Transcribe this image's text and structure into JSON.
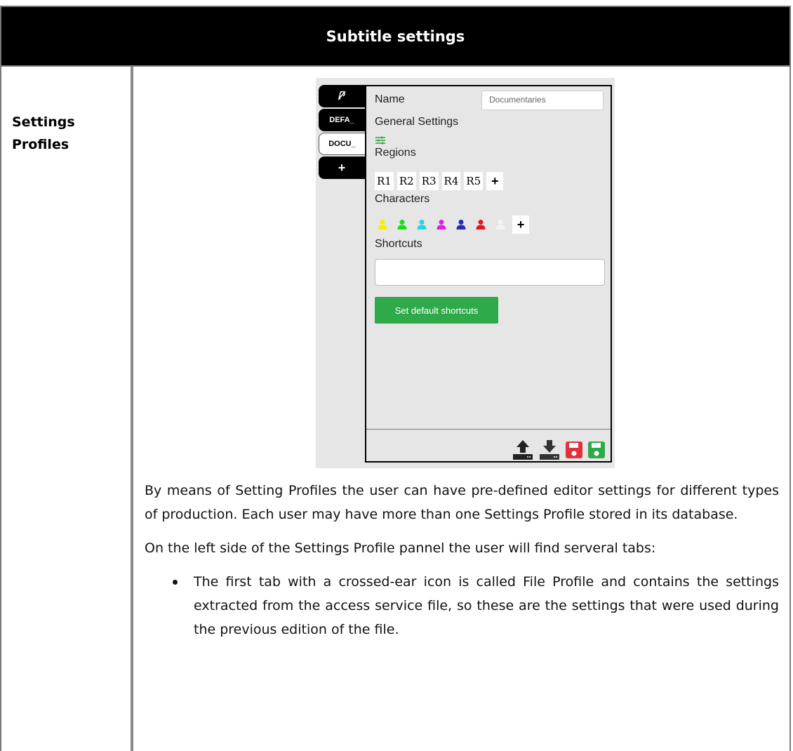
{
  "header": {
    "title": "Subtitle settings"
  },
  "row": {
    "label": "Settings Profiles"
  },
  "app": {
    "tabs": [
      {
        "label": "",
        "icon": "crossed-ear-icon"
      },
      {
        "label": "DEFA_"
      },
      {
        "label": "DOCU_"
      },
      {
        "label": "+"
      }
    ],
    "name_label": "Name",
    "name_value": "Documentaries",
    "general_settings_label": "General Settings",
    "regions_label": "Regions",
    "regions": [
      "R1",
      "R2",
      "R3",
      "R4",
      "R5"
    ],
    "add_label": "+",
    "characters_label": "Characters",
    "character_colors": [
      "#f2f200",
      "#16e016",
      "#26d6dc",
      "#e01ee0",
      "#2a2ab0",
      "#e01a1a",
      "#f4f4f4"
    ],
    "shortcuts_label": "Shortcuts",
    "shortcuts_value": "",
    "default_shortcuts_button": "Set default shortcuts",
    "footer_icons": [
      "upload-icon",
      "download-icon",
      "save-icon",
      "save-as-icon"
    ],
    "accent_color": "#2eaa4a",
    "save_color": "#e0323c"
  },
  "body": {
    "paragraph1": "By means of Setting Profiles the user can have pre-defined editor settings for different types of production. Each user may have more than one Settings Profile stored in its database.",
    "paragraph2": "On the left side of the Settings Profile pannel the user will find serveral tabs:",
    "bullets": [
      "The first tab with a crossed-ear icon is called File Profile and contains the settings extracted from the access service file, so these are the settings that were used during the previous edition of the file."
    ]
  }
}
